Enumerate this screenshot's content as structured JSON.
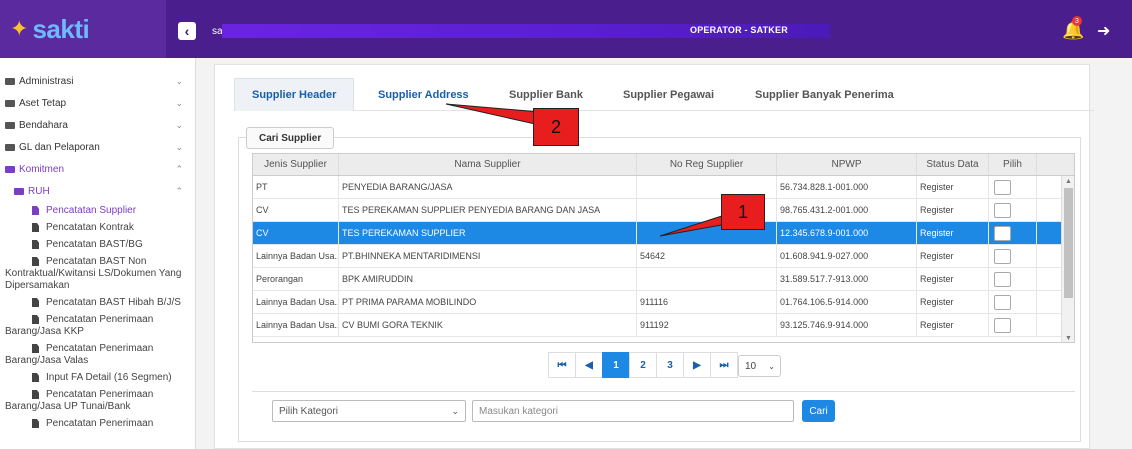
{
  "app": {
    "logo_text": "sakti",
    "user_short": "sai",
    "role": "OPERATOR - SATKER",
    "notif_count": "3"
  },
  "sidebar": {
    "menus": [
      {
        "label": "Administrasi",
        "chevron": "⌄"
      },
      {
        "label": "Aset Tetap",
        "chevron": "⌄"
      },
      {
        "label": "Bendahara",
        "chevron": "⌄"
      },
      {
        "label": "GL dan Pelaporan",
        "chevron": "⌄"
      },
      {
        "label": "Komitmen",
        "chevron": "⌃"
      }
    ],
    "submenu": {
      "label": "RUH",
      "chevron": "⌃"
    },
    "leaves": [
      "Pencatatan Supplier",
      "Pencatatan Kontrak",
      "Pencatatan BAST/BG",
      "Pencatatan BAST Non Kontraktual/Kwitansi LS/Dokumen Yang Dipersamakan",
      "Pencatatan BAST Hibah B/J/S",
      "Pencatatan Penerimaan Barang/Jasa KKP",
      "Pencatatan Penerimaan Barang/Jasa Valas",
      "Input FA Detail (16 Segmen)",
      "Pencatatan Penerimaan Barang/Jasa UP Tunai/Bank",
      "Pencatatan Penerimaan"
    ]
  },
  "tabs": [
    "Supplier Header",
    "Supplier Address",
    "Supplier Bank",
    "Supplier Pegawai",
    "Supplier Banyak Penerima"
  ],
  "legend": "Cari Supplier",
  "grid": {
    "headers": [
      "Jenis Supplier",
      "Nama Supplier",
      "No Reg Supplier",
      "NPWP",
      "Status Data",
      "Pilih"
    ],
    "rows": [
      {
        "jenis": "PT",
        "nama": "PENYEDIA BARANG/JASA",
        "noreg": "",
        "npwp": "56.734.828.1-001.000",
        "status": "Register"
      },
      {
        "jenis": "CV",
        "nama": "TES PEREKAMAN SUPPLIER PENYEDIA BARANG DAN JASA",
        "noreg": "",
        "npwp": "98.765.431.2-001.000",
        "status": "Register"
      },
      {
        "jenis": "CV",
        "nama": "TES PEREKAMAN SUPPLIER",
        "noreg": "",
        "npwp": "12.345.678.9-001.000",
        "status": "Register"
      },
      {
        "jenis": "Lainnya Badan Usa...",
        "nama": "PT.BHINNEKA MENTARIDIMENSI",
        "noreg": "54642",
        "npwp": "01.608.941.9-027.000",
        "status": "Register"
      },
      {
        "jenis": "Perorangan",
        "nama": "BPK AMIRUDDIN",
        "noreg": "",
        "npwp": "31.589.517.7-913.000",
        "status": "Register"
      },
      {
        "jenis": "Lainnya Badan Usa...",
        "nama": "PT PRIMA PARAMA MOBILINDO",
        "noreg": "911116",
        "npwp": "01.764.106.5-914.000",
        "status": "Register"
      },
      {
        "jenis": "Lainnya Badan Usa...",
        "nama": "CV BUMI GORA TEKNIK",
        "noreg": "911192",
        "npwp": "93.125.746.9-914.000",
        "status": "Register"
      }
    ]
  },
  "pager": {
    "first": "⏮",
    "prev": "◀",
    "pages": [
      "1",
      "2",
      "3"
    ],
    "next": "▶",
    "last": "⏭",
    "page_size": "10"
  },
  "filter": {
    "select_placeholder": "Pilih Kategori",
    "input_placeholder": "Masukan kategori",
    "button": "Cari"
  },
  "callouts": {
    "one": "1",
    "two": "2"
  }
}
